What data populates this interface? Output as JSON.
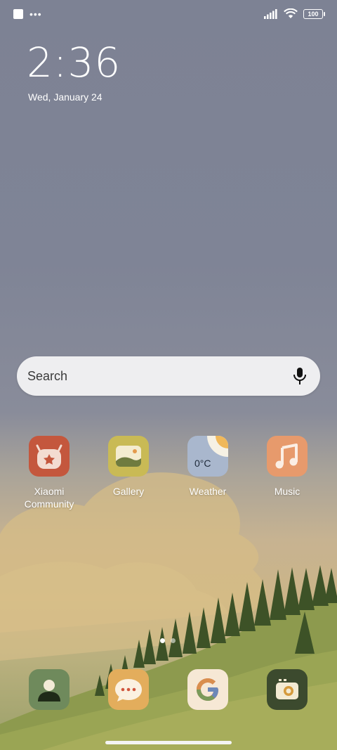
{
  "status_bar": {
    "battery": "100"
  },
  "lock": {
    "time": "2:36",
    "date": "Wed, January 24"
  },
  "search": {
    "placeholder": "Search"
  },
  "apps": [
    {
      "label": "Xiaomi Community",
      "icon": "xiaomi-community-icon",
      "color": "#c4573d"
    },
    {
      "label": "Gallery",
      "icon": "gallery-icon",
      "color": "#c9ba55"
    },
    {
      "label": "Weather",
      "icon": "weather-icon",
      "color": "#a9b7cd",
      "temp": "0°C"
    },
    {
      "label": "Music",
      "icon": "music-icon",
      "color": "#e79a6c"
    }
  ],
  "dock": [
    {
      "icon": "contacts-icon",
      "color": "#6f8a5c"
    },
    {
      "icon": "messages-icon",
      "color": "#e3ad5c"
    },
    {
      "icon": "google-icon",
      "color": "#f6e8d5"
    },
    {
      "icon": "camera-icon",
      "color": "#3c4a2e"
    }
  ],
  "pager": {
    "pages": 2,
    "active": 1
  }
}
